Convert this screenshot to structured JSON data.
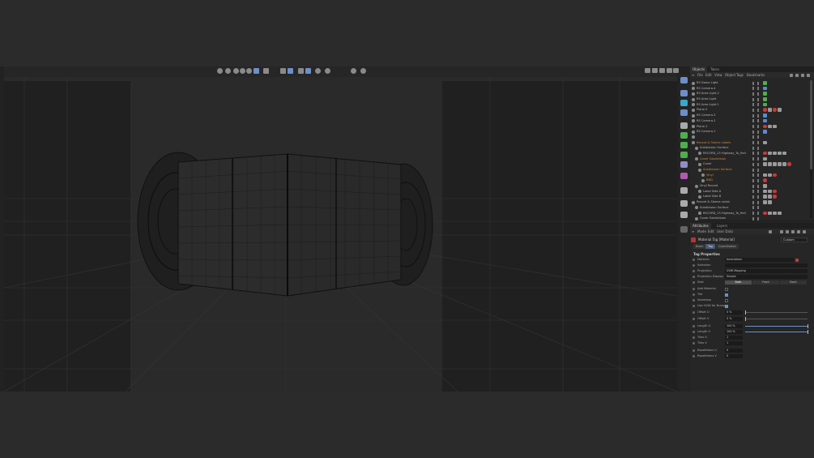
{
  "viewport": {
    "toolbar_icons": [
      "undo-icon",
      "redo-icon",
      "move-icon",
      "rotate-icon",
      "scale-icon",
      "select-icon",
      "live-select-icon",
      "model-mode-icon",
      "points-mode-icon",
      "edges-mode-icon",
      "polygons-mode-icon",
      "snap-icon",
      "axis-icon",
      "render-view-icon",
      "render-icon"
    ],
    "right_icons": [
      "view-layout-icon",
      "camera-icon",
      "display-icon",
      "filter-icon",
      "fullscreen-icon"
    ]
  },
  "object_manager": {
    "tabs": [
      "Objects",
      "Takes"
    ],
    "menu": [
      "File",
      "Edit",
      "View",
      "Object",
      "Tags",
      "Bookmarks"
    ],
    "objects": [
      {
        "name": "RS Dome Light",
        "indent": 0,
        "highlight": false,
        "tags": [
          "green"
        ]
      },
      {
        "name": "RS Camera.4",
        "indent": 0,
        "highlight": false,
        "tags": [
          "blue"
        ]
      },
      {
        "name": "RS Area Light.2",
        "indent": 0,
        "highlight": false,
        "tags": [
          "green"
        ]
      },
      {
        "name": "RS Area Light",
        "indent": 0,
        "highlight": false,
        "tags": [
          "green"
        ]
      },
      {
        "name": "RS Area Light.1",
        "indent": 0,
        "highlight": false,
        "tags": [
          "green"
        ]
      },
      {
        "name": "Plane.2",
        "indent": 0,
        "highlight": false,
        "tags": [
          "red",
          "grey",
          "red",
          "grey"
        ]
      },
      {
        "name": "RS Camera.3",
        "indent": 0,
        "highlight": false,
        "tags": [
          "blue"
        ]
      },
      {
        "name": "RS Camera.2",
        "indent": 0,
        "highlight": false,
        "tags": [
          "blue"
        ]
      },
      {
        "name": "Plane.1",
        "indent": 0,
        "highlight": false,
        "tags": [
          "red",
          "grey",
          "grey"
        ]
      },
      {
        "name": "RS Camera.1",
        "indent": 0,
        "highlight": false,
        "tags": [
          "blue"
        ]
      },
      {
        "name": "",
        "indent": 0,
        "highlight": false,
        "tags": []
      },
      {
        "name": "Record & Sleeve Labels",
        "indent": 0,
        "highlight": true,
        "tags": [
          "grey"
        ]
      },
      {
        "name": "Subdivision Surface",
        "indent": 1,
        "highlight": false,
        "tags": []
      },
      {
        "name": "RECORD_15 Highway_To_Hell",
        "indent": 2,
        "highlight": false,
        "tags": [
          "red",
          "grey",
          "grey",
          "grey",
          "grey"
        ]
      },
      {
        "name": "Cover Subdivision",
        "indent": 1,
        "highlight": true,
        "tags": [
          "grey"
        ]
      },
      {
        "name": "Cover",
        "indent": 2,
        "highlight": false,
        "tags": [
          "grey",
          "grey",
          "grey",
          "grey",
          "grey",
          "red"
        ]
      },
      {
        "name": "Subdivision Surface",
        "indent": 2,
        "highlight": true,
        "tags": []
      },
      {
        "name": "Vinyl",
        "indent": 3,
        "highlight": true,
        "tags": [
          "grey",
          "grey",
          "red"
        ]
      },
      {
        "name": "BND",
        "indent": 3,
        "highlight": true,
        "tags": [
          "red"
        ]
      },
      {
        "name": "Vinyl Record",
        "indent": 1,
        "highlight": false,
        "tags": [
          "grey"
        ]
      },
      {
        "name": "Label Side A",
        "indent": 2,
        "highlight": false,
        "tags": [
          "grey",
          "grey",
          "red"
        ]
      },
      {
        "name": "Label Side B",
        "indent": 2,
        "highlight": false,
        "tags": [
          "grey",
          "grey",
          "red"
        ]
      },
      {
        "name": "Record & Sleeve unlab",
        "indent": 0,
        "highlight": false,
        "tags": [
          "grey",
          "grey"
        ]
      },
      {
        "name": "Subdivision Surface",
        "indent": 1,
        "highlight": false,
        "tags": []
      },
      {
        "name": "RECORD_15 Highway_To_Hell",
        "indent": 2,
        "highlight": false,
        "tags": [
          "red",
          "grey",
          "grey",
          "grey"
        ]
      },
      {
        "name": "Cover Subdivision",
        "indent": 1,
        "highlight": false,
        "tags": []
      }
    ]
  },
  "attribute_manager": {
    "tabs": [
      "Attributes",
      "Layers"
    ],
    "menu": [
      "Mode",
      "Edit",
      "User Data"
    ],
    "header_title": "Material Tag [Material]",
    "mode_dropdown": "Custom",
    "subtabs": [
      "Basic",
      "Tag",
      "Coordinates"
    ],
    "active_subtab": "Tag",
    "section": "Tag Properties",
    "rows": [
      {
        "label": "Material",
        "type": "field",
        "value": "Innenleben"
      },
      {
        "label": "Selection",
        "type": "field",
        "value": ""
      },
      {
        "label": "Projection",
        "type": "field",
        "value": "UVW Mapping"
      },
      {
        "label": "Projection Display",
        "type": "field",
        "value": "Simple"
      },
      {
        "label": "Side",
        "type": "segments",
        "options": [
          "Both",
          "Front",
          "Back"
        ],
        "selected": "Both"
      },
      {
        "label": "Add Material",
        "type": "check",
        "checked": false
      },
      {
        "label": "Tile",
        "type": "check",
        "checked": true
      },
      {
        "label": "Seamless",
        "type": "check",
        "checked": false
      },
      {
        "label": "Use UVW for Bump",
        "type": "check",
        "checked": true
      },
      {
        "label": "Offset U",
        "type": "slider",
        "value": "0 %",
        "fraction": 0
      },
      {
        "label": "Offset V",
        "type": "slider",
        "value": "0 %",
        "fraction": 0
      },
      {
        "label": "Length U",
        "type": "slider",
        "value": "100 %",
        "fraction": 1
      },
      {
        "label": "Length V",
        "type": "slider",
        "value": "100 %",
        "fraction": 1
      },
      {
        "label": "Tiles U",
        "type": "num",
        "value": "1"
      },
      {
        "label": "Tiles V",
        "type": "num",
        "value": "1"
      },
      {
        "label": "Repetitions U",
        "type": "num",
        "value": "0"
      },
      {
        "label": "Repetitions V",
        "type": "num",
        "value": "0"
      }
    ]
  },
  "colors": {
    "accent": "#6d8fc9",
    "highlight_text": "#d08a3a",
    "tag_red": "#c83a3a",
    "tag_green": "#4fae4f",
    "tag_blue": "#5a8ad0",
    "tag_grey": "#9a9a9a"
  }
}
